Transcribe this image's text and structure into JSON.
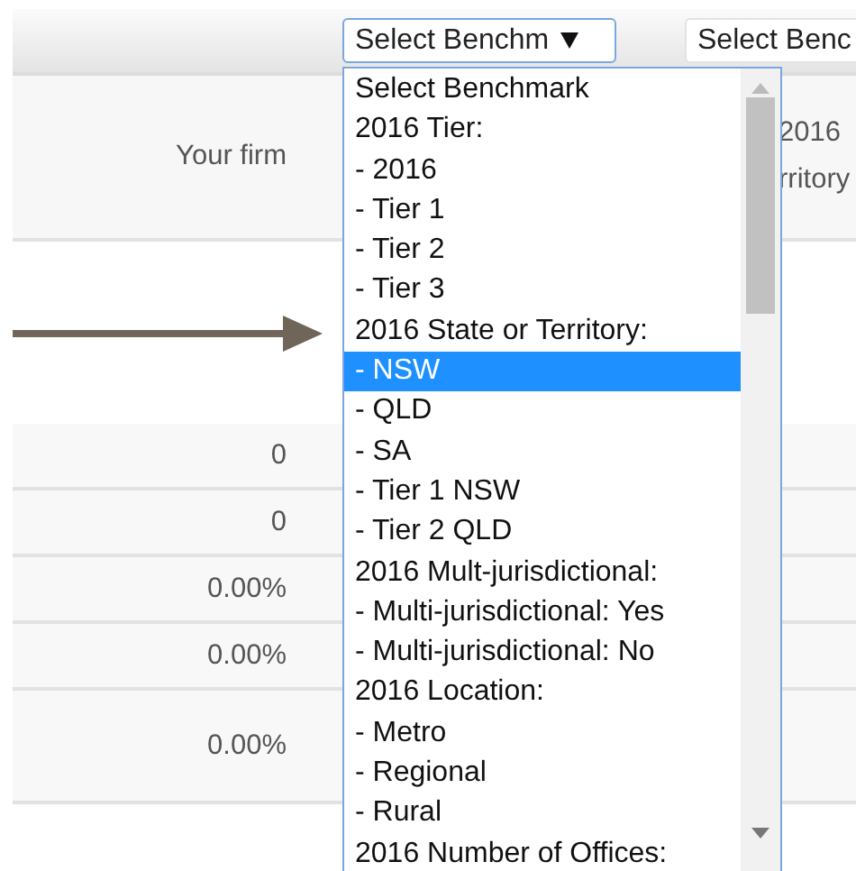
{
  "toolbar": {
    "selects": [
      {
        "value": "Select Benchm",
        "open": true
      },
      {
        "value": "Select Benc",
        "open": false
      }
    ]
  },
  "table": {
    "columns": [
      {
        "lines": [
          "Your firm"
        ]
      },
      {
        "lines": [
          "2016",
          "rritory"
        ]
      }
    ],
    "rows": [
      {
        "cells": [
          "0"
        ]
      },
      {
        "cells": [
          "0"
        ]
      },
      {
        "cells": [
          "0.00%"
        ]
      },
      {
        "cells": [
          "0.00%"
        ]
      },
      {
        "cells": [
          "0.00%"
        ],
        "tall": true
      }
    ]
  },
  "dropdown": {
    "options": [
      {
        "label": "Select Benchmark",
        "selected": false
      },
      {
        "label": "2016 Tier:",
        "selected": false
      },
      {
        "label": "- 2016",
        "selected": false
      },
      {
        "label": "- Tier 1",
        "selected": false
      },
      {
        "label": "- Tier 2",
        "selected": false
      },
      {
        "label": "- Tier 3",
        "selected": false
      },
      {
        "label": "2016 State or Territory:",
        "selected": false
      },
      {
        "label": "- NSW",
        "selected": true
      },
      {
        "label": "- QLD",
        "selected": false
      },
      {
        "label": "- SA",
        "selected": false
      },
      {
        "label": "- Tier 1 NSW",
        "selected": false
      },
      {
        "label": "- Tier 2 QLD",
        "selected": false
      },
      {
        "label": "2016 Mult-jurisdictional:",
        "selected": false
      },
      {
        "label": "- Multi-jurisdictional: Yes",
        "selected": false
      },
      {
        "label": "- Multi-jurisdictional: No",
        "selected": false
      },
      {
        "label": "2016 Location:",
        "selected": false
      },
      {
        "label": "- Metro",
        "selected": false
      },
      {
        "label": "- Regional",
        "selected": false
      },
      {
        "label": "- Rural",
        "selected": false
      },
      {
        "label": "2016 Number of Offices:",
        "selected": false
      }
    ]
  },
  "annotation": {
    "kind": "arrow"
  }
}
